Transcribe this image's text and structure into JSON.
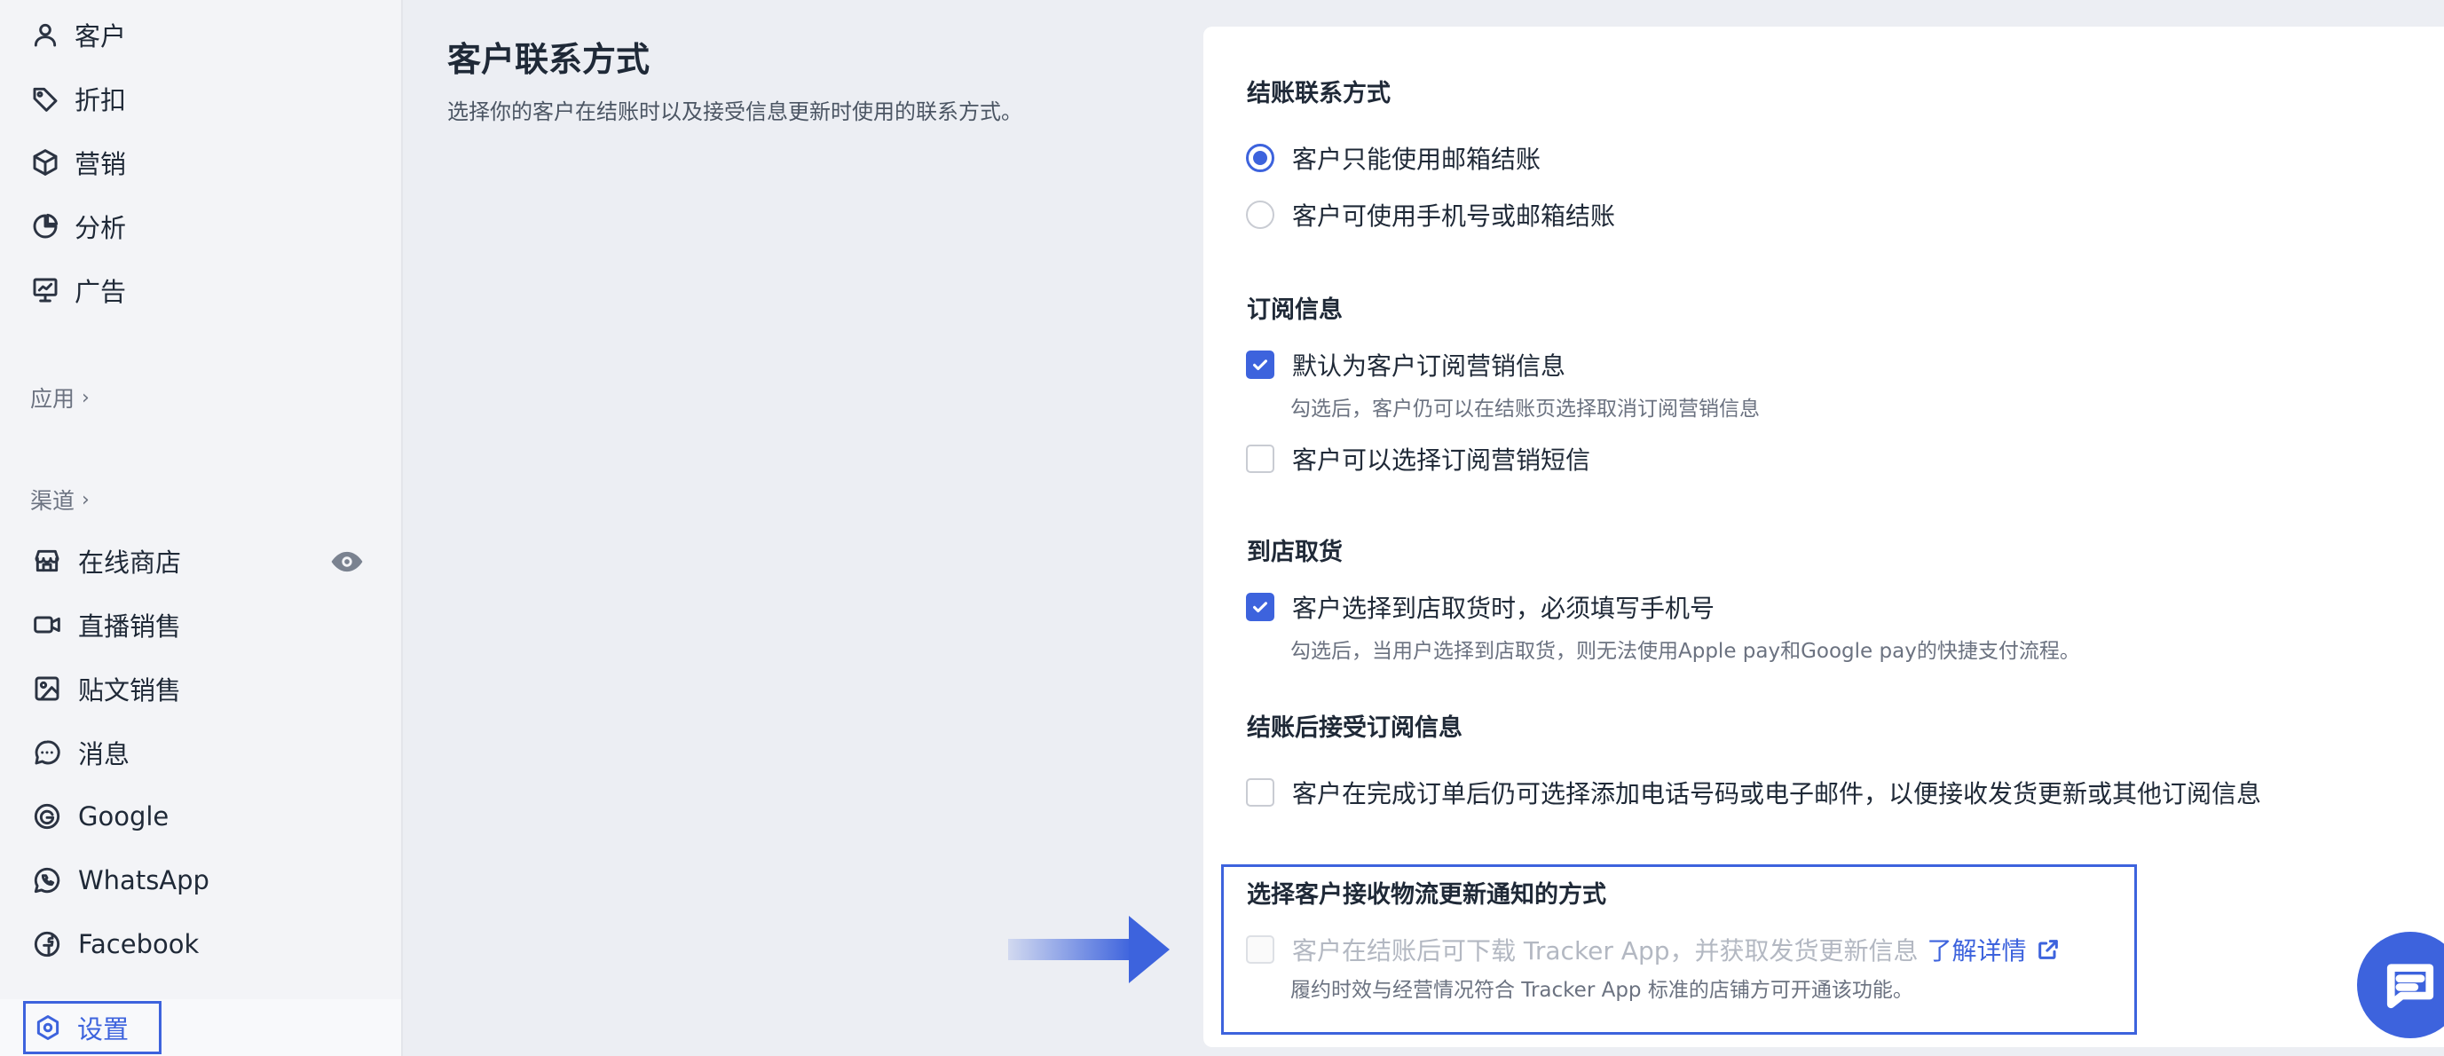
{
  "sidebar": {
    "top_items": [
      {
        "label": "客户",
        "icon": "user-icon"
      },
      {
        "label": "折扣",
        "icon": "tag-icon"
      },
      {
        "label": "营销",
        "icon": "cube-icon"
      },
      {
        "label": "分析",
        "icon": "pie-chart-icon"
      },
      {
        "label": "广告",
        "icon": "presentation-icon"
      }
    ],
    "apps_label": "应用",
    "channels_label": "渠道",
    "channels": [
      {
        "label": "在线商店",
        "icon": "store-icon"
      },
      {
        "label": "直播销售",
        "icon": "video-icon"
      },
      {
        "label": "贴文销售",
        "icon": "image-icon"
      },
      {
        "label": "消息",
        "icon": "chat-bubble-icon"
      },
      {
        "label": "Google",
        "icon": "google-icon"
      },
      {
        "label": "WhatsApp",
        "icon": "whatsapp-icon"
      },
      {
        "label": "Facebook",
        "icon": "facebook-icon"
      }
    ],
    "settings_label": "设置"
  },
  "page": {
    "title": "客户联系方式",
    "description": "选择你的客户在结账时以及接受信息更新时使用的联系方式。"
  },
  "checkout_contact": {
    "title": "结账联系方式",
    "options": [
      {
        "label": "客户只能使用邮箱结账",
        "selected": true
      },
      {
        "label": "客户可使用手机号或邮箱结账",
        "selected": false
      }
    ]
  },
  "subscription": {
    "title": "订阅信息",
    "default_subscribe_label": "默认为客户订阅营销信息",
    "default_subscribe_hint": "勾选后，客户仍可以在结账页选择取消订阅营销信息",
    "sms_label": "客户可以选择订阅营销短信"
  },
  "pickup": {
    "title": "到店取货",
    "phone_required_label": "客户选择到店取货时，必须填写手机号",
    "phone_required_hint": "勾选后，当用户选择到店取货，则无法使用Apple pay和Google pay的快捷支付流程。"
  },
  "post_checkout": {
    "title": "结账后接受订阅信息",
    "option_label": "客户在完成订单后仍可选择添加电话号码或电子邮件，以便接收发货更新或其他订阅信息"
  },
  "logistics": {
    "title": "选择客户接收物流更新通知的方式",
    "tracker_label": "客户在结账后可下载 Tracker App，并获取发货更新信息",
    "learn_more": "了解详情",
    "tracker_hint": "履约时效与经营情况符合 Tracker App 标准的店铺方可开通该功能。"
  },
  "colors": {
    "accent": "#3d63dd",
    "sidebar_bg": "#f3f4f7",
    "page_bg": "#eceef3"
  }
}
